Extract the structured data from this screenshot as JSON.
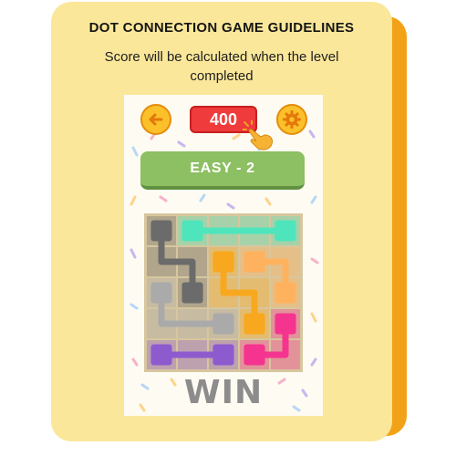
{
  "card": {
    "title": "DOT CONNECTION GAME GUIDELINES",
    "subtitle": "Score will be calculated when the level completed"
  },
  "game": {
    "score": "400",
    "level_label": "EASY - 2",
    "result_text": "WIN",
    "back_icon": "arrow-left-icon",
    "settings_icon": "gear-icon",
    "pointer_icon": "pointing-hand-icon"
  },
  "colors": {
    "card_bg": "#fbe79a",
    "card_shadow": "#f2a216",
    "score_red": "#ef3b3b",
    "banner_green": "#8dbf63",
    "button_yellow": "#fbc02a"
  },
  "board": {
    "rows": 5,
    "cols": 5,
    "paths": [
      {
        "color": "#4ee5bd",
        "cells": [
          [
            0,
            1
          ],
          [
            0,
            2
          ],
          [
            0,
            3
          ],
          [
            0,
            4
          ]
        ]
      },
      {
        "color": "#6b6b6b",
        "cells": [
          [
            0,
            0
          ],
          [
            1,
            0
          ],
          [
            1,
            1
          ],
          [
            2,
            1
          ]
        ]
      },
      {
        "color": "#aaaaaa",
        "cells": [
          [
            2,
            0
          ],
          [
            3,
            0
          ],
          [
            3,
            1
          ],
          [
            3,
            2
          ]
        ]
      },
      {
        "color": "#f8a81e",
        "cells": [
          [
            1,
            2
          ],
          [
            2,
            2
          ],
          [
            2,
            3
          ],
          [
            3,
            3
          ]
        ]
      },
      {
        "color": "#ffb25e",
        "cells": [
          [
            1,
            3
          ],
          [
            1,
            4
          ],
          [
            2,
            4
          ]
        ]
      },
      {
        "color": "#8e5bcf",
        "cells": [
          [
            4,
            0
          ],
          [
            4,
            1
          ],
          [
            4,
            2
          ]
        ]
      },
      {
        "color": "#f5348f",
        "cells": [
          [
            3,
            4
          ],
          [
            4,
            4
          ],
          [
            4,
            3
          ]
        ]
      }
    ]
  }
}
